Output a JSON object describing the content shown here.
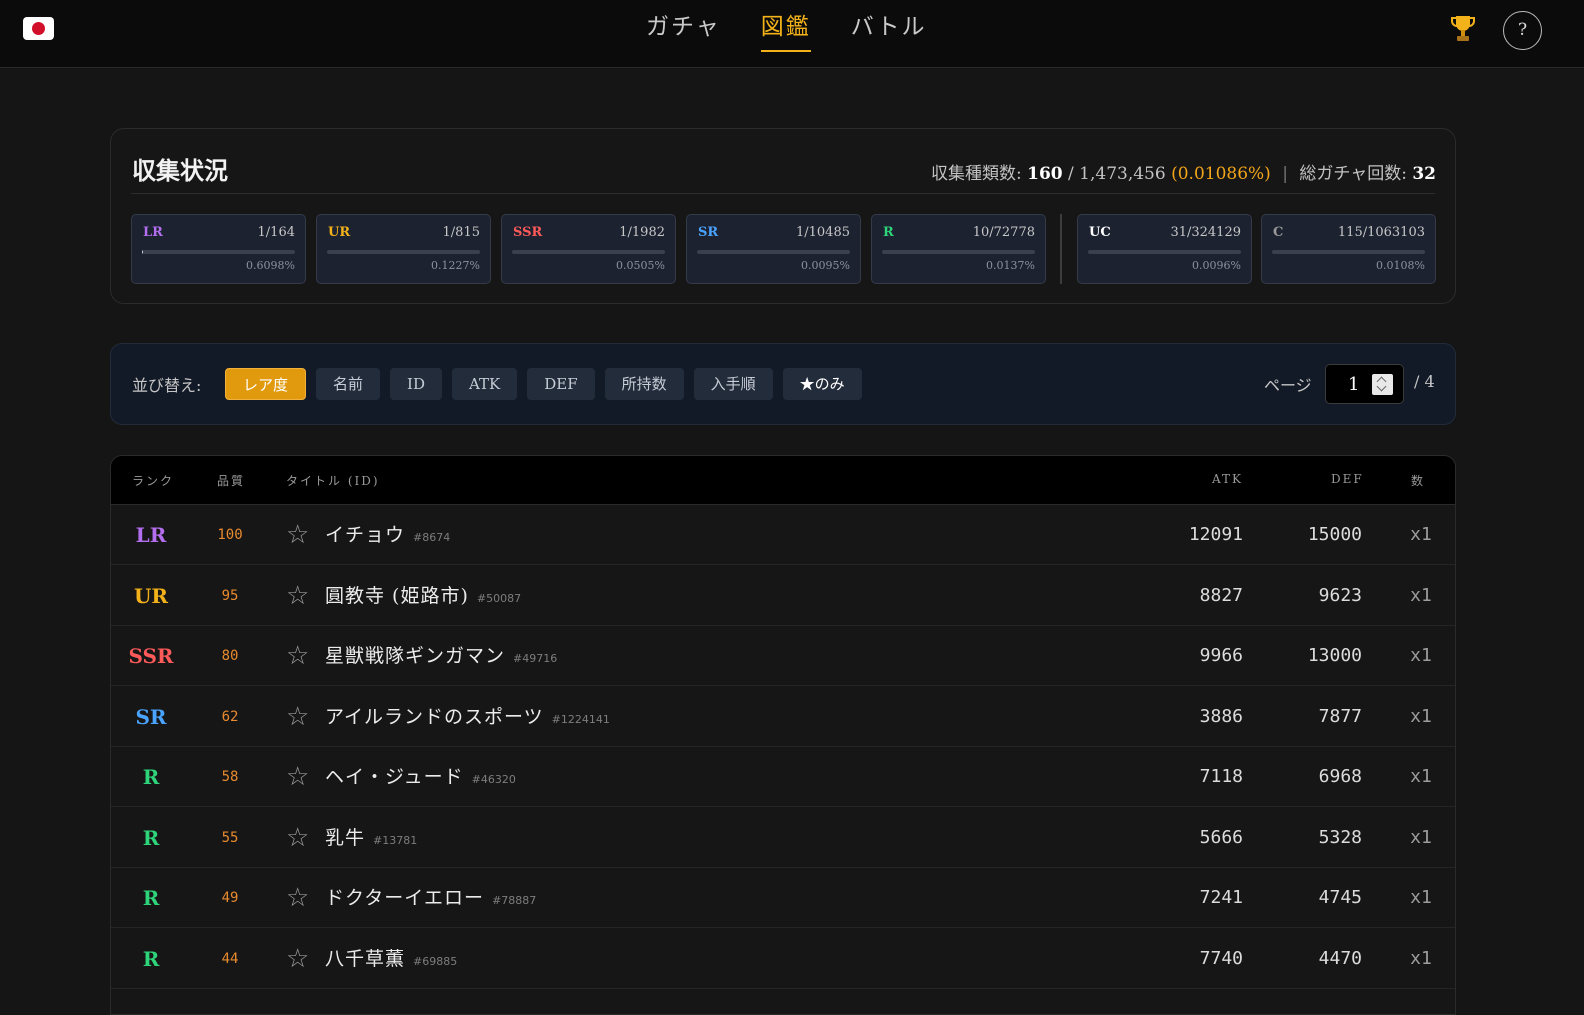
{
  "nav": {
    "tabs": [
      {
        "label": "ガチャ"
      },
      {
        "label": "図鑑"
      },
      {
        "label": "バトル"
      }
    ],
    "active": "図鑑",
    "help_label": "?"
  },
  "collection": {
    "title": "収集状況",
    "types_label": "収集種類数:",
    "types_owned": "160",
    "types_total": "/ 1,473,456",
    "types_pct": "(0.01086%)",
    "separator": "|",
    "gacha_label": "総ガチャ回数:",
    "gacha_count": "32",
    "rarities": [
      {
        "name": "LR",
        "count": "1/164",
        "pct": "0.6098%",
        "fraction": 0.006098,
        "color": "#b46ff0"
      },
      {
        "name": "UR",
        "count": "1/815",
        "pct": "0.1227%",
        "fraction": 0.001227,
        "color": "#f3b21a"
      },
      {
        "name": "SSR",
        "count": "1/1982",
        "pct": "0.0505%",
        "fraction": 0.000505,
        "color": "#ff5a5a"
      },
      {
        "name": "SR",
        "count": "1/10485",
        "pct": "0.0095%",
        "fraction": 9.5e-05,
        "color": "#4aa3ff"
      },
      {
        "name": "R",
        "count": "10/72778",
        "pct": "0.0137%",
        "fraction": 0.000137,
        "color": "#2ed47a"
      },
      {
        "name": "UC",
        "count": "31/324129",
        "pct": "0.0096%",
        "fraction": 9.6e-05,
        "color": "#ffffff"
      },
      {
        "name": "C",
        "count": "115/1063103",
        "pct": "0.0108%",
        "fraction": 0.000108,
        "color": "#9a9a9a"
      }
    ]
  },
  "sort": {
    "label": "並び替え:",
    "buttons": [
      {
        "label": "レア度",
        "active": true
      },
      {
        "label": "名前"
      },
      {
        "label": "ID"
      },
      {
        "label": "ATK"
      },
      {
        "label": "DEF"
      },
      {
        "label": "所持数"
      },
      {
        "label": "入手順"
      },
      {
        "label": "★のみ"
      }
    ],
    "page_label": "ページ",
    "page_value": "1",
    "page_total": "/ 4"
  },
  "table": {
    "headers": {
      "rank": "ランク",
      "quality": "品質",
      "title": "タイトル (ID)",
      "atk": "ATK",
      "def": "DEF",
      "count": "数"
    },
    "rows": [
      {
        "rank": "LR",
        "rank_color": "#b46ff0",
        "quality": "100",
        "title": "イチョウ",
        "id": "#8674",
        "atk": "12091",
        "def": "15000",
        "count": "x1"
      },
      {
        "rank": "UR",
        "rank_color": "#f3b21a",
        "quality": "95",
        "title": "圓教寺 (姫路市)",
        "id": "#50087",
        "atk": "8827",
        "def": "9623",
        "count": "x1"
      },
      {
        "rank": "SSR",
        "rank_color": "#ff5a5a",
        "quality": "80",
        "title": "星獣戦隊ギンガマン",
        "id": "#49716",
        "atk": "9966",
        "def": "13000",
        "count": "x1"
      },
      {
        "rank": "SR",
        "rank_color": "#4aa3ff",
        "quality": "62",
        "title": "アイルランドのスポーツ",
        "id": "#1224141",
        "atk": "3886",
        "def": "7877",
        "count": "x1"
      },
      {
        "rank": "R",
        "rank_color": "#2ed47a",
        "quality": "58",
        "title": "ヘイ・ジュード",
        "id": "#46320",
        "atk": "7118",
        "def": "6968",
        "count": "x1"
      },
      {
        "rank": "R",
        "rank_color": "#2ed47a",
        "quality": "55",
        "title": "乳牛",
        "id": "#13781",
        "atk": "5666",
        "def": "5328",
        "count": "x1"
      },
      {
        "rank": "R",
        "rank_color": "#2ed47a",
        "quality": "49",
        "title": "ドクターイエロー",
        "id": "#78887",
        "atk": "7241",
        "def": "4745",
        "count": "x1"
      },
      {
        "rank": "R",
        "rank_color": "#2ed47a",
        "quality": "44",
        "title": "八千草薫",
        "id": "#69885",
        "atk": "7740",
        "def": "4470",
        "count": "x1"
      }
    ]
  },
  "icons": {
    "flag": "japan-flag-icon",
    "trophy": "trophy-icon",
    "star": "star-outline-icon"
  }
}
